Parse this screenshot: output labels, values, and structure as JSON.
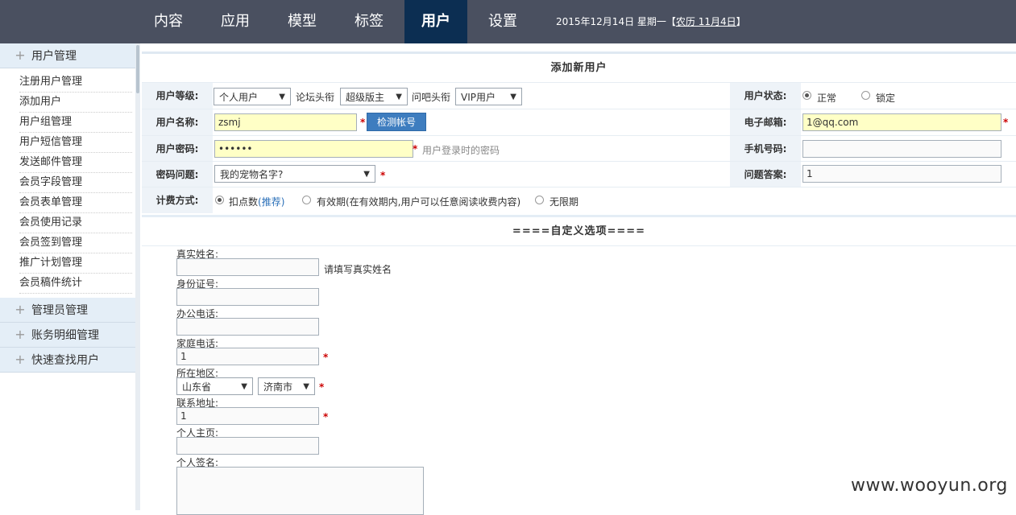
{
  "nav": {
    "items": [
      "内容",
      "应用",
      "模型",
      "标签",
      "用户",
      "设置"
    ],
    "active": "用户",
    "date_prefix": "2015年12月14日 星期一【",
    "lunar": "农历 11月4日",
    "date_suffix": "】"
  },
  "sidebar": {
    "sections": [
      {
        "label": "用户管理",
        "icon": "plus-icon"
      },
      {
        "label": "管理员管理",
        "icon": "plus-icon"
      },
      {
        "label": "账务明细管理",
        "icon": "plus-icon"
      },
      {
        "label": "快速查找用户",
        "icon": "plus-icon"
      }
    ],
    "links": [
      "注册用户管理",
      "添加用户",
      "用户组管理",
      "用户短信管理",
      "发送邮件管理",
      "会员字段管理",
      "会员表单管理",
      "会员使用记录",
      "会员签到管理",
      "推广计划管理",
      "会员稿件统计"
    ]
  },
  "form": {
    "title": "添加新用户",
    "level_label": "用户等级:",
    "level_value": "个人用户",
    "forum_label": "论坛头衔",
    "forum_value": "超级版主",
    "wenba_label": "问吧头衔",
    "wenba_value": "VIP用户",
    "status_label": "用户状态:",
    "status_normal": "正常",
    "status_locked": "锁定",
    "username_label": "用户名称:",
    "username_value": "zsmj",
    "check_button": "检测帐号",
    "email_label": "电子邮箱:",
    "email_value": "1@qq.com",
    "password_label": "用户密码:",
    "password_value": "••••••",
    "password_hint": "用户登录时的密码",
    "mobile_label": "手机号码:",
    "mobile_value": "",
    "question_label": "密码问题:",
    "question_value": "我的宠物名字?",
    "answer_label": "问题答案:",
    "answer_value": "1",
    "billing_label": "计费方式:",
    "billing_points": "扣点数",
    "billing_recommend": "(推荐)",
    "billing_period": "有效期(在有效期内,用户可以任意阅读收费内容)",
    "billing_unlimited": "无限期",
    "required_mark": "*"
  },
  "custom": {
    "title": "====自定义选项====",
    "realname_label": "真实姓名:",
    "realname_value": "",
    "realname_hint": "请填写真实姓名",
    "idcard_label": "身份证号:",
    "idcard_value": "",
    "office_phone_label": "办公电话:",
    "office_phone_value": "",
    "home_phone_label": "家庭电话:",
    "home_phone_value": "1",
    "region_label": "所在地区:",
    "province_value": "山东省",
    "city_value": "济南市",
    "address_label": "联系地址:",
    "address_value": "1",
    "homepage_label": "个人主页:",
    "homepage_value": "",
    "signature_label": "个人签名:"
  },
  "watermark": "www.wooyun.org"
}
